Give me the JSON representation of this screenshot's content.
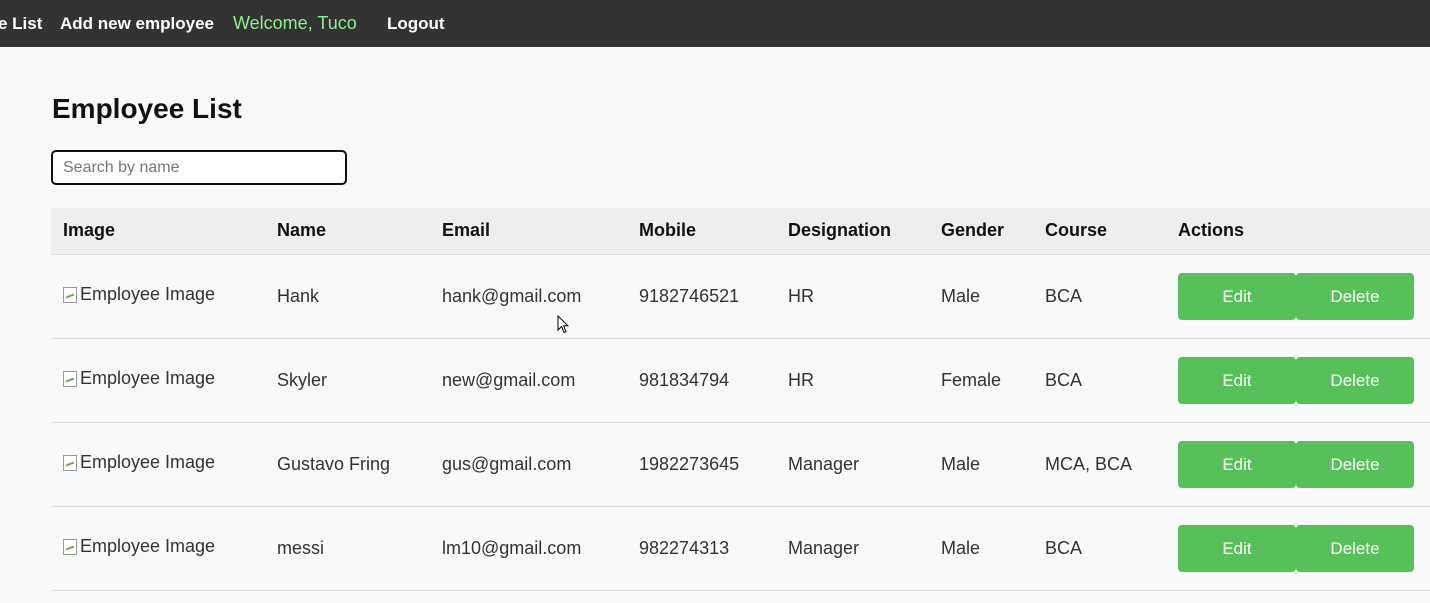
{
  "nav": {
    "employee_list": "e List",
    "add_new_employee": "Add new employee",
    "welcome": "Welcome, Tuco",
    "logout": "Logout"
  },
  "page": {
    "title": "Employee List"
  },
  "search": {
    "placeholder": "Search by name",
    "value": ""
  },
  "table": {
    "headers": [
      "Image",
      "Name",
      "Email",
      "Mobile",
      "Designation",
      "Gender",
      "Course",
      "Actions"
    ],
    "rows": [
      {
        "image_alt": "Employee Image",
        "name": "Hank",
        "email": "hank@gmail.com",
        "mobile": "9182746521",
        "designation": "HR",
        "gender": "Male",
        "course": "BCA"
      },
      {
        "image_alt": "Employee Image",
        "name": "Skyler",
        "email": "new@gmail.com",
        "mobile": "981834794",
        "designation": "HR",
        "gender": "Female",
        "course": "BCA"
      },
      {
        "image_alt": "Employee Image",
        "name": "Gustavo Fring",
        "email": "gus@gmail.com",
        "mobile": "1982273645",
        "designation": "Manager",
        "gender": "Male",
        "course": "MCA, BCA"
      },
      {
        "image_alt": "Employee Image",
        "name": "messi",
        "email": "lm10@gmail.com",
        "mobile": "982274313",
        "designation": "Manager",
        "gender": "Male",
        "course": "BCA"
      }
    ],
    "edit_label": "Edit",
    "delete_label": "Delete"
  },
  "colors": {
    "nav_bg": "#333333",
    "welcome": "#90ee90",
    "button": "#57c05a",
    "page_bg": "#f8f9fa",
    "header_bg": "#eeeeee"
  }
}
